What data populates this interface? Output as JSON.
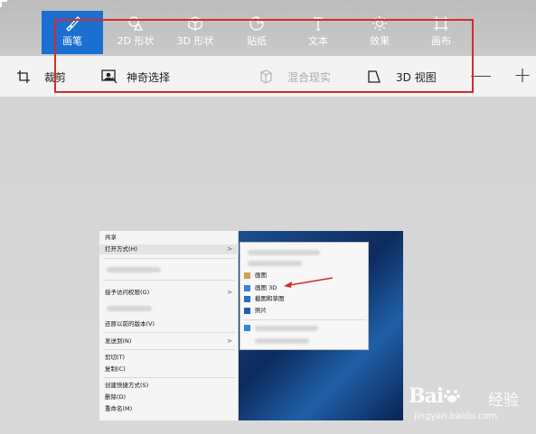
{
  "ribbon": {
    "tabs": [
      {
        "label": "画笔",
        "icon": "brush-icon",
        "active": true
      },
      {
        "label": "2D 形状",
        "icon": "shapes-2d-icon"
      },
      {
        "label": "3D 形状",
        "icon": "shapes-3d-icon"
      },
      {
        "label": "贴纸",
        "icon": "sticker-icon"
      },
      {
        "label": "文本",
        "icon": "text-icon"
      },
      {
        "label": "效果",
        "icon": "effects-icon"
      },
      {
        "label": "画布",
        "icon": "canvas-icon"
      }
    ],
    "accent": "#1a6fd0"
  },
  "toolbar": {
    "crop_label": "裁剪",
    "magic_select_label": "神奇选择",
    "mixed_reality_label": "混合现实",
    "view3d_label": "3D 视图",
    "zoom_out": "—",
    "zoom_in": "+"
  },
  "highlight_color": "#d52b2b",
  "screenshot": {
    "context_menu": {
      "share": "共享",
      "open_with": "打开方式(H)",
      "give_access": "授予访问权限(G)",
      "restore": "还原以前的版本(V)",
      "send_to": "发送到(N)",
      "cut": "剪切(T)",
      "copy": "复制(C)",
      "create_shortcut": "创建快捷方式(S)",
      "delete": "删除(D)",
      "rename": "重命名(M)"
    },
    "open_with_menu": {
      "paint": "画图",
      "paint3d": "画图 3D",
      "snip": "截图和草图",
      "photos": "照片"
    }
  },
  "watermark": {
    "brand": "Bai",
    "brand_suffix": "du",
    "cn": "经验",
    "url": "jingyan.baidu.com"
  }
}
